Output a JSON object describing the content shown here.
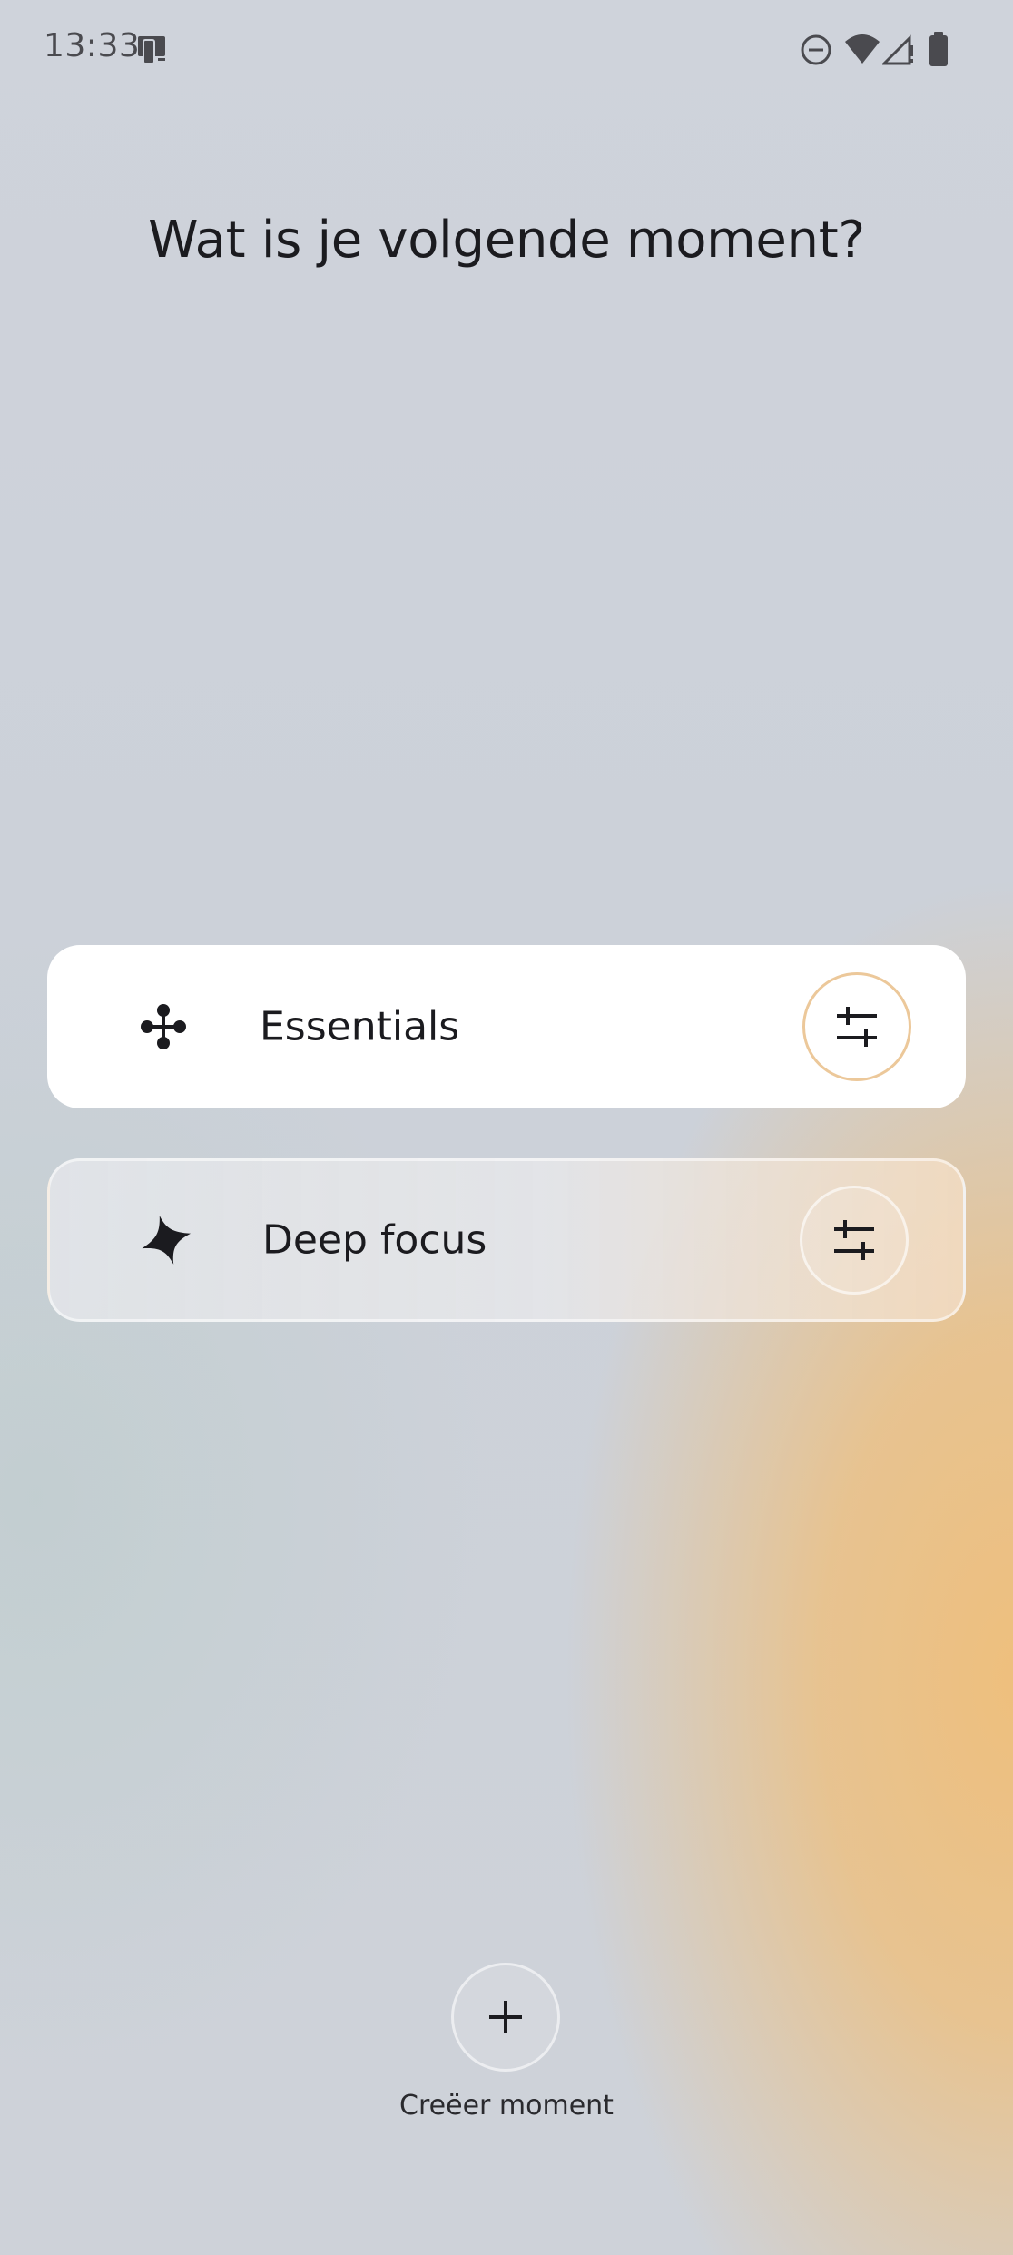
{
  "status_bar": {
    "time": "13:33",
    "icons": [
      "screen-share-icon",
      "do-not-disturb-icon",
      "wifi-icon",
      "cellular-signal-icon",
      "battery-icon"
    ]
  },
  "page": {
    "title": "Wat is je volgende moment?"
  },
  "moments": [
    {
      "label": "Essentials",
      "icon": "four-dots-icon",
      "selected": true
    },
    {
      "label": "Deep focus",
      "icon": "four-point-star-icon",
      "selected": false
    }
  ],
  "create": {
    "label": "Creëer moment",
    "icon": "plus-icon"
  },
  "colors": {
    "accent_orange": "#efbf82",
    "text": "#1b1b1f",
    "card_white": "#ffffff"
  }
}
